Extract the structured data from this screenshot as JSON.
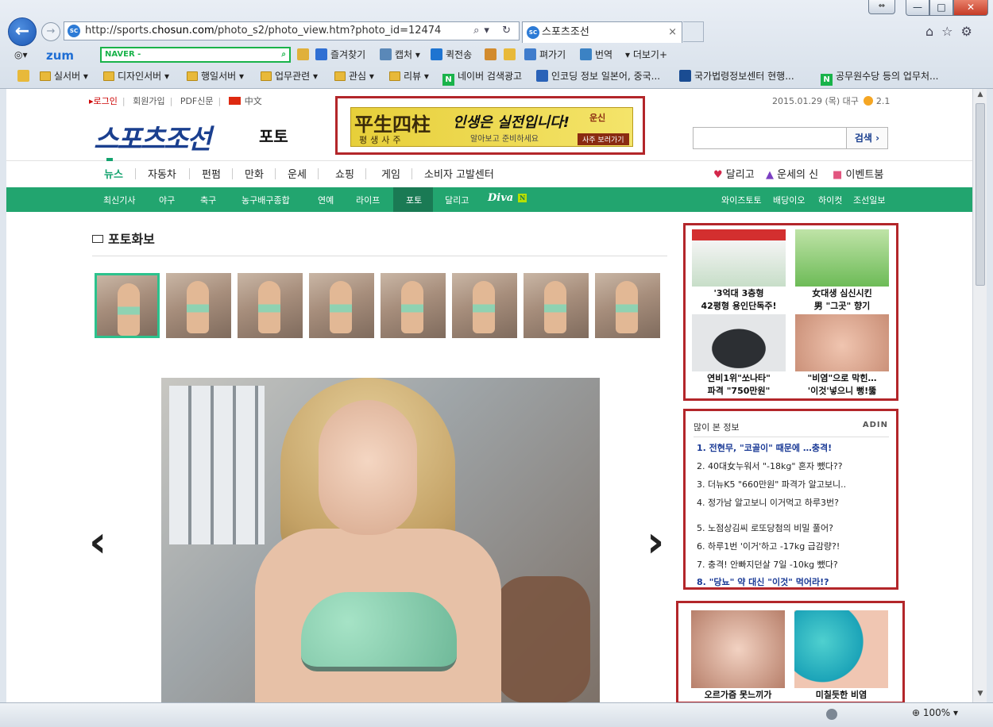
{
  "browser": {
    "url_prefix": "http://sports.",
    "url_domain": "chosun.com",
    "url_path": "/photo_s2/photo_view.htm?photo_id=12474",
    "url_controls": "⌕▾ ↻",
    "tab_title": "스포츠조선",
    "tab_close": "×",
    "tab_favicon": "SC",
    "win_restore": "⇔",
    "win_min": "—",
    "win_max": "□",
    "win_close": "✕",
    "right_icons": "⌂☆⚙",
    "zoom": "100%"
  },
  "toolbar": {
    "zum": "zum",
    "naver_placeholder": "NAVER -",
    "items": [
      "즐겨찾기",
      "캡처 ▾",
      "퀵전송",
      "펴가기",
      "번역",
      "▾ 더보기+"
    ],
    "items2": []
  },
  "favorites": [
    "실서버 ▾",
    "디자인서버 ▾",
    "행일서버 ▾",
    "업무관련 ▾",
    "관심 ▾",
    "리뷰 ▾",
    "네이버 검색광고",
    "인코딩 정보 일본어, 중국...",
    "국가법령정보센터 현행...",
    "공무원수당 등의 업무처..."
  ],
  "util": {
    "login": "▸로그인",
    "signup": "회원가입",
    "pdf": "PDF신문",
    "chinese": "中文",
    "date": "2015.01.29 (목) 대구",
    "temp": "2.1"
  },
  "logo": {
    "main": "스포츠조선",
    "sub": "포토"
  },
  "banner": {
    "hanja": "平生四柱",
    "hangul_sub": "평생사주",
    "copy": "인생은 실전입니다!",
    "brand": "운신",
    "note": "알아보고 준비하세요",
    "button": "사주 보러가기"
  },
  "search": {
    "button": "검색 ›"
  },
  "nav1": {
    "items": [
      "뉴스",
      "자동차",
      "펀펌",
      "만화",
      "운세",
      "쇼핑",
      "게임",
      "소비자 고발센터"
    ],
    "right": [
      "달리고",
      "운세의 신",
      "이벤트붐"
    ]
  },
  "nav2": {
    "items": [
      "최신기사",
      "야구",
      "축구",
      "농구배구종합",
      "연예",
      "라이프",
      "포토",
      "달리고"
    ],
    "diva": "Diva",
    "diva_badge": "N",
    "right": [
      "와이즈토토",
      "배당이오",
      "하이컷",
      "조선일보"
    ]
  },
  "page_title": "포토화보",
  "gallery": {
    "thumb_count": 8,
    "selected_index": 0,
    "prev": "‹",
    "next": "›"
  },
  "ad1": {
    "items": [
      {
        "caption1": "'3억대 3층형",
        "caption2": "42평형 용인단독주!"
      },
      {
        "caption1": "女대생 심신시킨",
        "caption2": "男 \"그곳\" 향기"
      },
      {
        "caption1": "연비1위\"쏘나타\"",
        "caption2": "파격 \"750만원\""
      },
      {
        "caption1": "\"비염\"으로 막힌…",
        "caption2": "'이것'넣으니 뻥!뚫"
      }
    ]
  },
  "ad2": {
    "heading": "많이 본 정보",
    "brand": "ADIN",
    "items": [
      "1. 전현무, \"코골이\" 때문에 …충격!",
      "2. 40대女누워서 \"-18kg\" 혼자 뺐다??",
      "3. 더뉴K5 \"660만원\" 파격가 알고보니..",
      "4. 정가남 알고보니 이거먹고 하루3번?",
      "5. 노점상김씨 로또당첨의 비밀 풀어?",
      "6. 하루1번 '이거'하고 -17kg 급감량?!",
      "7. 충격! 안빠지던살 7일 -10kg 뺐다?",
      "8. \"당뇨\" 약 대신 \"이것\" 먹어라!?"
    ]
  },
  "ad3": {
    "items": [
      {
        "caption": "오르가즘 못느끼가"
      },
      {
        "caption": "미칠듯한 비염"
      }
    ]
  },
  "colors": {
    "accent_green": "#22a56f",
    "ad_border": "#b3262a",
    "logo_blue": "#1a3f8f"
  }
}
